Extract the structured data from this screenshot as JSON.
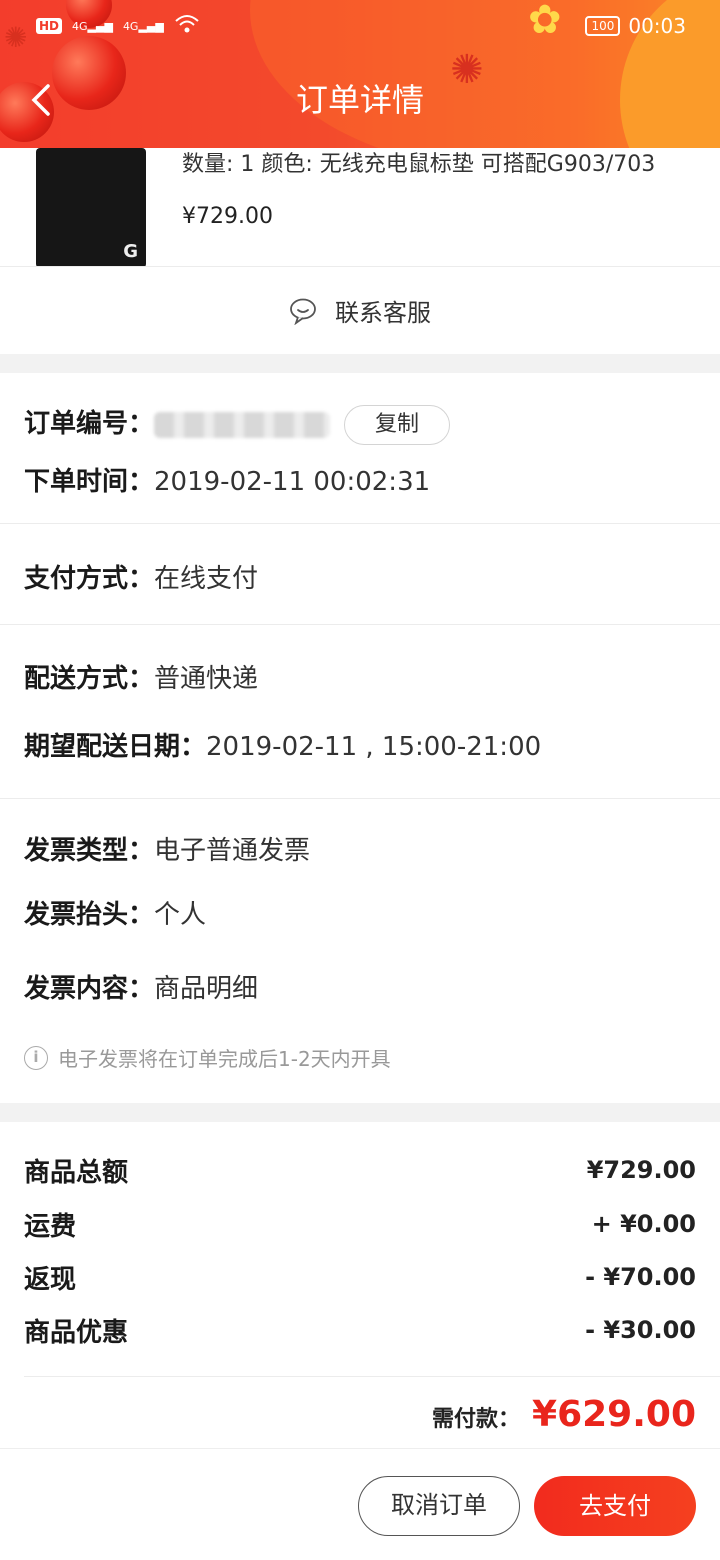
{
  "status_bar": {
    "hd": "HD",
    "signal_1": "4G",
    "signal_2": "4G",
    "battery": "100",
    "time": "00:03"
  },
  "header": {
    "back_icon": "chevron-left-icon",
    "title": "订单详情"
  },
  "product": {
    "spec": "数量: 1 颜色: 无线充电鼠标垫 可搭配G903/703",
    "price": "¥729.00",
    "logo": "G"
  },
  "contact": {
    "icon": "chat-bubble-icon",
    "label": "联系客服"
  },
  "order": {
    "number_label": "订单编号：",
    "copy_label": "复制",
    "time_label": "下单时间：",
    "time_value": "2019-02-11 00:02:31",
    "payment_label": "支付方式：",
    "payment_value": "在线支付",
    "delivery_label": "配送方式：",
    "delivery_value": "普通快递",
    "expected_label": "期望配送日期：",
    "expected_value": "2019-02-11 , 15:00-21:00",
    "invoice_type_label": "发票类型：",
    "invoice_type_value": "电子普通发票",
    "invoice_title_label": "发票抬头：",
    "invoice_title_value": "个人",
    "invoice_content_label": "发票内容：",
    "invoice_content_value": "商品明细",
    "note_icon": "info-icon",
    "note": "电子发票将在订单完成后1-2天内开具"
  },
  "prices": {
    "items": [
      {
        "label": "商品总额",
        "value": "¥729.00"
      },
      {
        "label": "运费",
        "value": "+ ¥0.00"
      },
      {
        "label": "返现",
        "value": "- ¥70.00"
      },
      {
        "label": "商品优惠",
        "value": "- ¥30.00"
      }
    ],
    "total_label": "需付款：",
    "total_value": "¥629.00",
    "accent": "#e9251c"
  },
  "actions": {
    "cancel": "取消订单",
    "pay": "去支付"
  }
}
